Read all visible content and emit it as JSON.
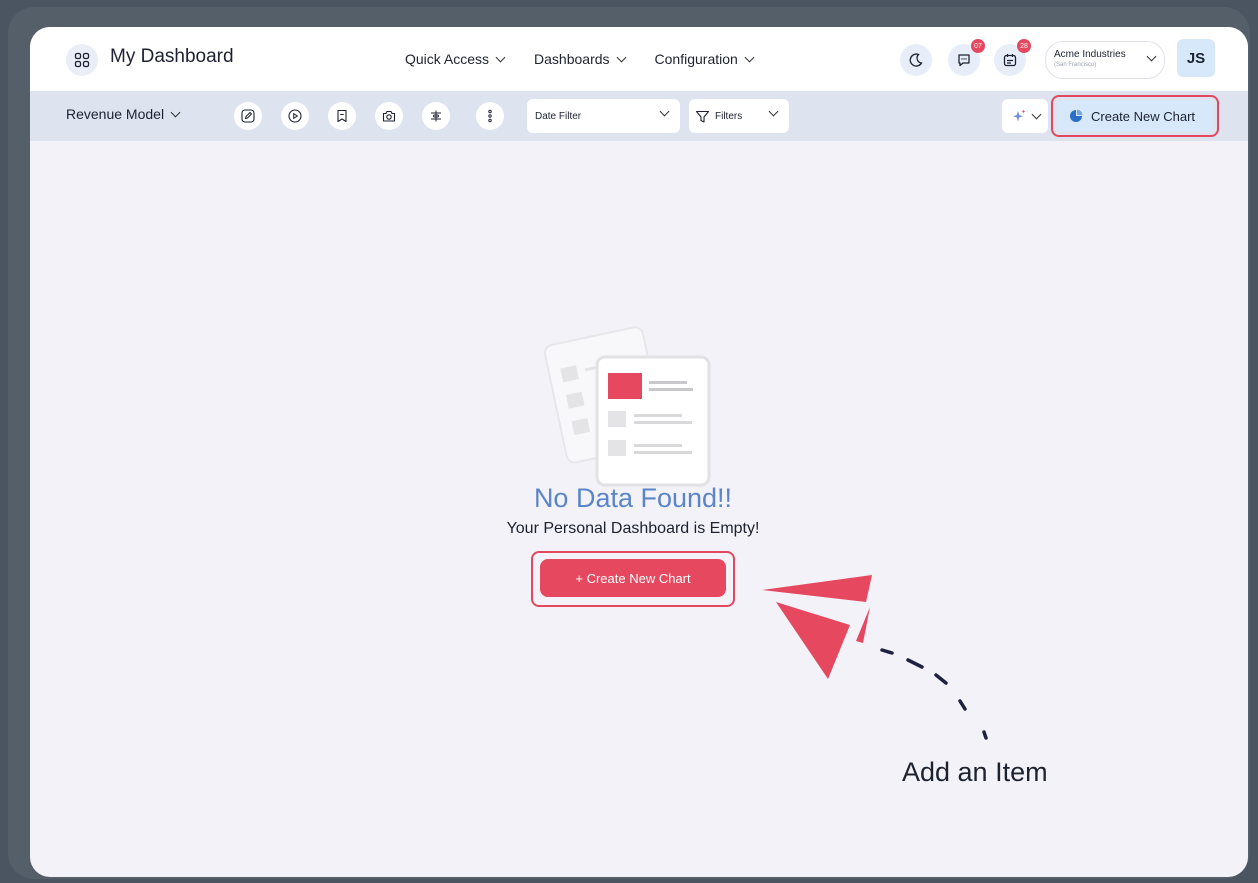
{
  "header": {
    "title": "My Dashboard",
    "nav": [
      "Quick Access",
      "Dashboards",
      "Configuration"
    ],
    "messages_badge": "07",
    "calendar_badge": "28",
    "company_name": "Acme Industries",
    "company_location": "(San Francisco)",
    "user_initials": "JS"
  },
  "toolbar": {
    "model": "Revenue Model",
    "date_filter": "Date Filter",
    "filters": "Filters",
    "create_chart": "Create New Chart"
  },
  "empty_state": {
    "title": "No Data Found!!",
    "subtitle": "Your Personal Dashboard is Empty!",
    "button": "+ Create New Chart"
  },
  "annotation": {
    "label": "Add an Item"
  },
  "colors": {
    "accent": "#e5485f",
    "title_blue": "#5b85c6",
    "toolbar_bg": "#dde3ef",
    "create_bg": "#d7e8fb"
  }
}
